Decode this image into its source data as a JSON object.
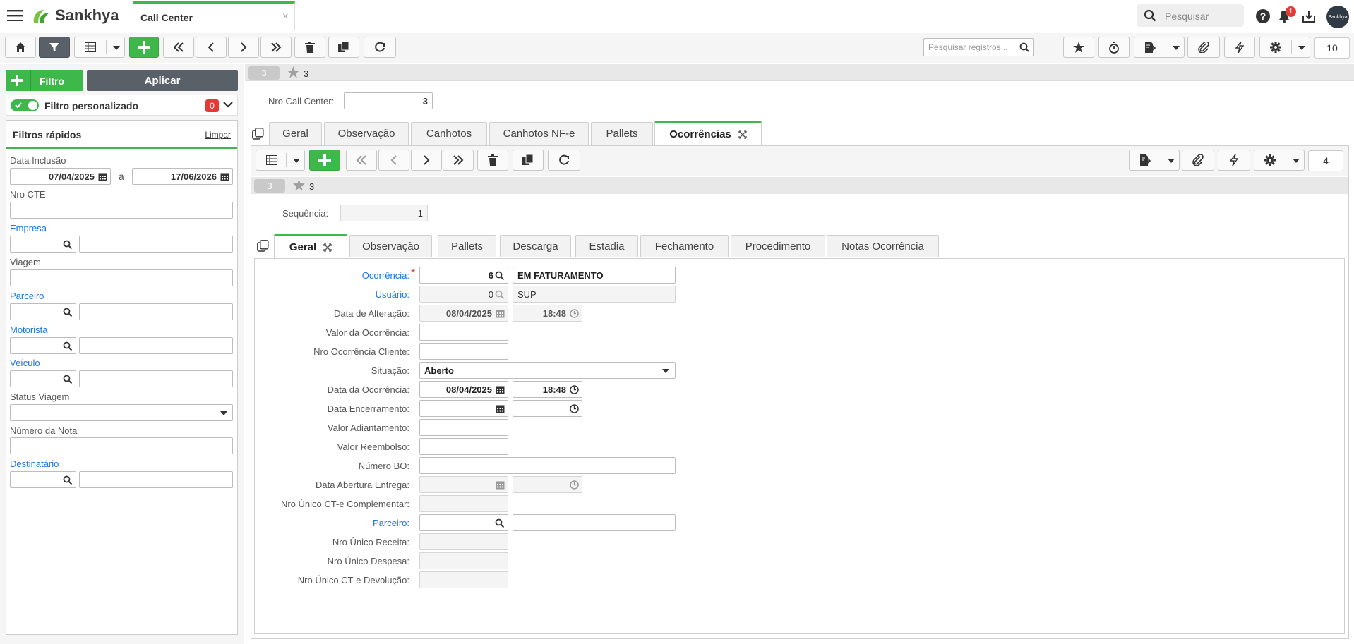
{
  "app": {
    "brand": "Sankhya",
    "tab_title": "Call Center",
    "search_placeholder": "Pesquisar",
    "notif_count": "1",
    "avatar_text": "Sankhya"
  },
  "toolbar": {
    "search_records_placeholder": "Pesquisar registros...",
    "page_size": "10"
  },
  "filters": {
    "add_filter_label": "Filtro",
    "apply_label": "Aplicar",
    "custom_filter_label": "Filtro personalizado",
    "custom_filter_count": "0",
    "quick_filters_title": "Filtros rápidos",
    "clear_label": "Limpar",
    "data_inclusao_label": "Data Inclusão",
    "date_from": "07/04/2025",
    "date_sep": "a",
    "date_to": "17/06/2026",
    "nro_cte_label": "Nro CTE",
    "empresa_label": "Empresa",
    "viagem_label": "Viagem",
    "parceiro_label": "Parceiro",
    "motorista_label": "Motorista",
    "veiculo_label": "Veículo",
    "status_viagem_label": "Status Viagem",
    "numero_nota_label": "Número da Nota",
    "destinatario_label": "Destinatário"
  },
  "record": {
    "id_badge": "3",
    "fav_count": "3",
    "nro_call_center_label": "Nro Call Center:",
    "nro_call_center_value": "3"
  },
  "tabs": [
    "Geral",
    "Observação",
    "Canhotos",
    "Canhotos NF-e",
    "Pallets",
    "Ocorrências"
  ],
  "sub": {
    "page_size": "4",
    "id_badge": "3",
    "fav_count": "3",
    "sequencia_label": "Sequência:",
    "sequencia_value": "1",
    "tabs": [
      "Geral",
      "Observação",
      "Pallets",
      "Descarga",
      "Estadia",
      "Fechamento",
      "Procedimento",
      "Notas Ocorrência"
    ]
  },
  "form": {
    "ocorrencia_label": "Ocorrência:",
    "ocorrencia_code": "6",
    "ocorrencia_desc": "EM FATURAMENTO",
    "usuario_label": "Usuário:",
    "usuario_code": "0",
    "usuario_desc": "SUP",
    "data_alteracao_label": "Data de Alteração:",
    "data_alteracao_date": "08/04/2025",
    "data_alteracao_time": "18:48",
    "valor_ocorrencia_label": "Valor da Ocorrência:",
    "nro_ocorrencia_cliente_label": "Nro Ocorrência Cliente:",
    "situacao_label": "Situação:",
    "situacao_value": "Aberto",
    "data_ocorrencia_label": "Data da Ocorrência:",
    "data_ocorrencia_date": "08/04/2025",
    "data_ocorrencia_time": "18:48",
    "data_encerramento_label": "Data Encerramento:",
    "valor_adiantamento_label": "Valor Adiantamento:",
    "valor_reembolso_label": "Valor Reembolso:",
    "numero_bo_label": "Número BO:",
    "data_abertura_entrega_label": "Data Abertura Entrega:",
    "nro_unico_cte_compl_label": "Nro Único CT-e Complementar:",
    "parceiro_label": "Parceiro:",
    "nro_unico_receita_label": "Nro Único Receita:",
    "nro_unico_despesa_label": "Nro Único Despesa:",
    "nro_unico_cte_devol_label": "Nro Único CT-e Devolução:"
  }
}
